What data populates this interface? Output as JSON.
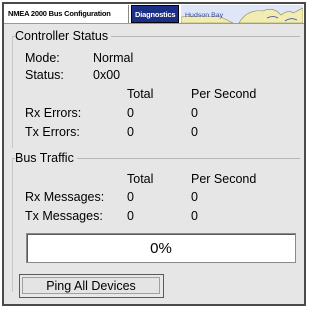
{
  "tabs": [
    {
      "label": "NMEA 2000 Bus Configuration"
    },
    {
      "label": "Diagnostics"
    }
  ],
  "map": {
    "label": "Hudson Bay"
  },
  "controller_status": {
    "title": "Controller Status",
    "mode_label": "Mode:",
    "mode_value": "Normal",
    "status_label": "Status:",
    "status_value": "0x00",
    "col_total": "Total",
    "col_per_second": "Per Second",
    "rows": [
      {
        "label": "Rx Errors:",
        "total": "0",
        "per_second": "0"
      },
      {
        "label": "Tx Errors:",
        "total": "0",
        "per_second": "0"
      }
    ]
  },
  "bus_traffic": {
    "title": "Bus Traffic",
    "col_total": "Total",
    "col_per_second": "Per Second",
    "rows": [
      {
        "label": "Rx Messages:",
        "total": "0",
        "per_second": "0"
      },
      {
        "label": "Tx Messages:",
        "total": "0",
        "per_second": "0"
      }
    ],
    "progress_text": "0%",
    "progress_value": 0
  },
  "actions": {
    "ping_label": "Ping All Devices"
  },
  "colors": {
    "active_tab": "#1c2f86",
    "panel_bg": "#e6e6e6"
  }
}
